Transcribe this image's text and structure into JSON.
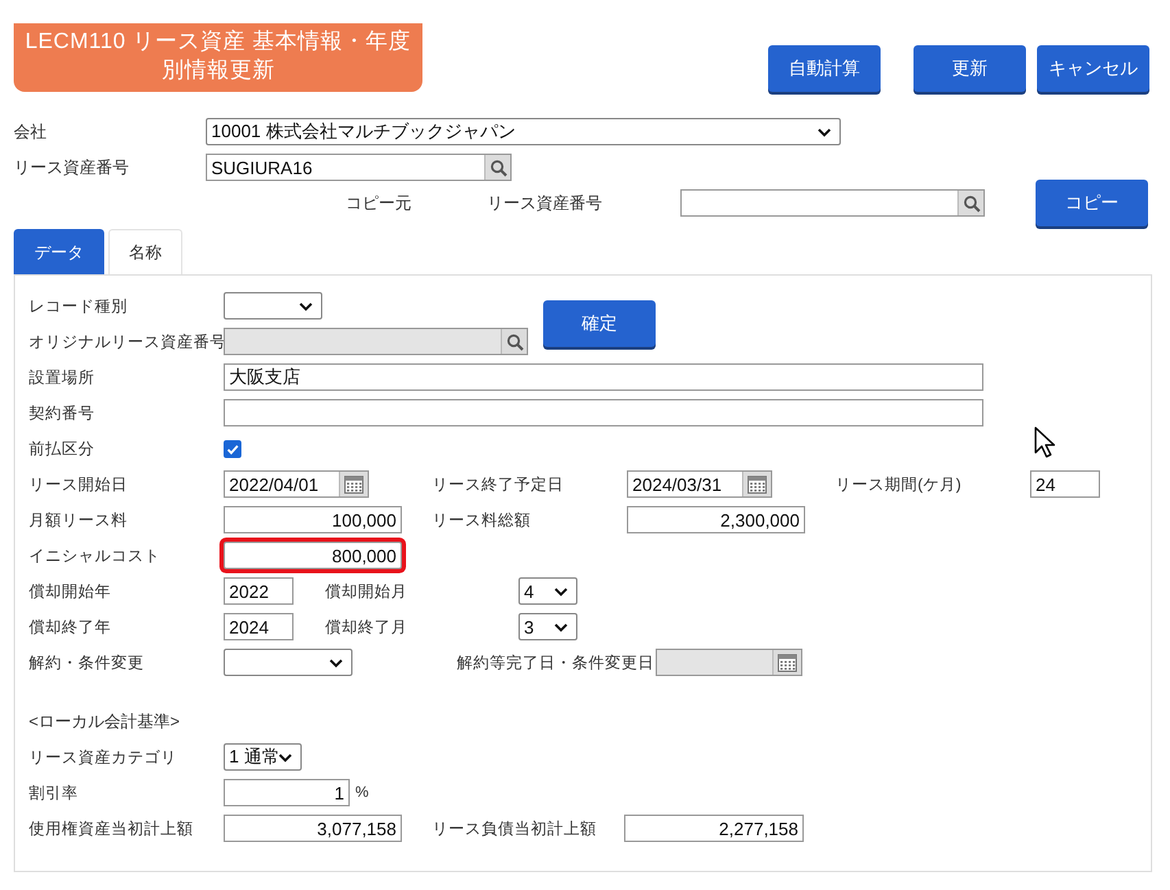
{
  "title": "LECM110 リース資産 基本情報・年度別情報更新",
  "actions": [
    "自動計算",
    "更新",
    "キャンセル"
  ],
  "header_fields": [
    {
      "label": "会社",
      "kind": "select",
      "value": "10001 株式会社マルチブックジャパン"
    },
    {
      "label": "リース資産番号",
      "kind": "lookup",
      "value": "SUGIURA16"
    }
  ],
  "copy_source": {
    "label": "コピー元",
    "field_label": "リース資産番号",
    "button": "コピー"
  },
  "tabs": [
    {
      "label": "データ",
      "selected": true
    },
    {
      "label": "名称",
      "selected": false
    }
  ],
  "confirm_button": "確定",
  "rows": [
    [
      {
        "label": "レコード種別",
        "kind": "select"
      }
    ],
    [
      {
        "label": "オリジナルリース資産番号",
        "kind": "lookup",
        "disabled": true
      }
    ],
    [
      {
        "label": "設置場所",
        "kind": "text",
        "value": "大阪支店"
      }
    ],
    [
      {
        "label": "契約番号",
        "kind": "text"
      }
    ],
    [
      {
        "label": "前払区分",
        "kind": "checkbox",
        "checked": true
      }
    ],
    [
      {
        "label": "リース開始日",
        "kind": "date",
        "value": "2022/04/01"
      },
      {
        "label": "リース終了予定日",
        "kind": "date",
        "value": "2024/03/31"
      },
      {
        "label": "リース期間(ケ月)",
        "kind": "text",
        "value": "24"
      }
    ],
    [
      {
        "label": "月額リース料",
        "kind": "number",
        "value": "100,000"
      },
      {
        "label": "リース料総額",
        "kind": "number",
        "value": "2,300,000"
      }
    ],
    [
      {
        "label": "イニシャルコスト",
        "kind": "number",
        "value": "800,000",
        "highlighted": true
      }
    ],
    [
      {
        "label": "償却開始年",
        "kind": "text",
        "value": "2022"
      },
      {
        "label": "償却開始月",
        "kind": "select",
        "value": "4"
      }
    ],
    [
      {
        "label": "償却終了年",
        "kind": "text",
        "value": "2024"
      },
      {
        "label": "償却終了月",
        "kind": "select",
        "value": "3"
      }
    ],
    [
      {
        "label": "解約・条件変更",
        "kind": "select"
      },
      {
        "label": "解約等完了日・条件変更日",
        "kind": "date",
        "disabled": true
      }
    ]
  ],
  "section_heading": "<ローカル会計基準>",
  "local_rows": [
    [
      {
        "label": "リース資産カテゴリ",
        "kind": "select",
        "value": "1 通常"
      }
    ],
    [
      {
        "label": "割引率",
        "kind": "number",
        "value": "1",
        "suffix": "%"
      }
    ],
    [
      {
        "label": "使用権資産当初計上額",
        "kind": "number",
        "value": "3,077,158"
      },
      {
        "label": "リース負債当初計上額",
        "kind": "number",
        "value": "2,277,158"
      }
    ]
  ]
}
